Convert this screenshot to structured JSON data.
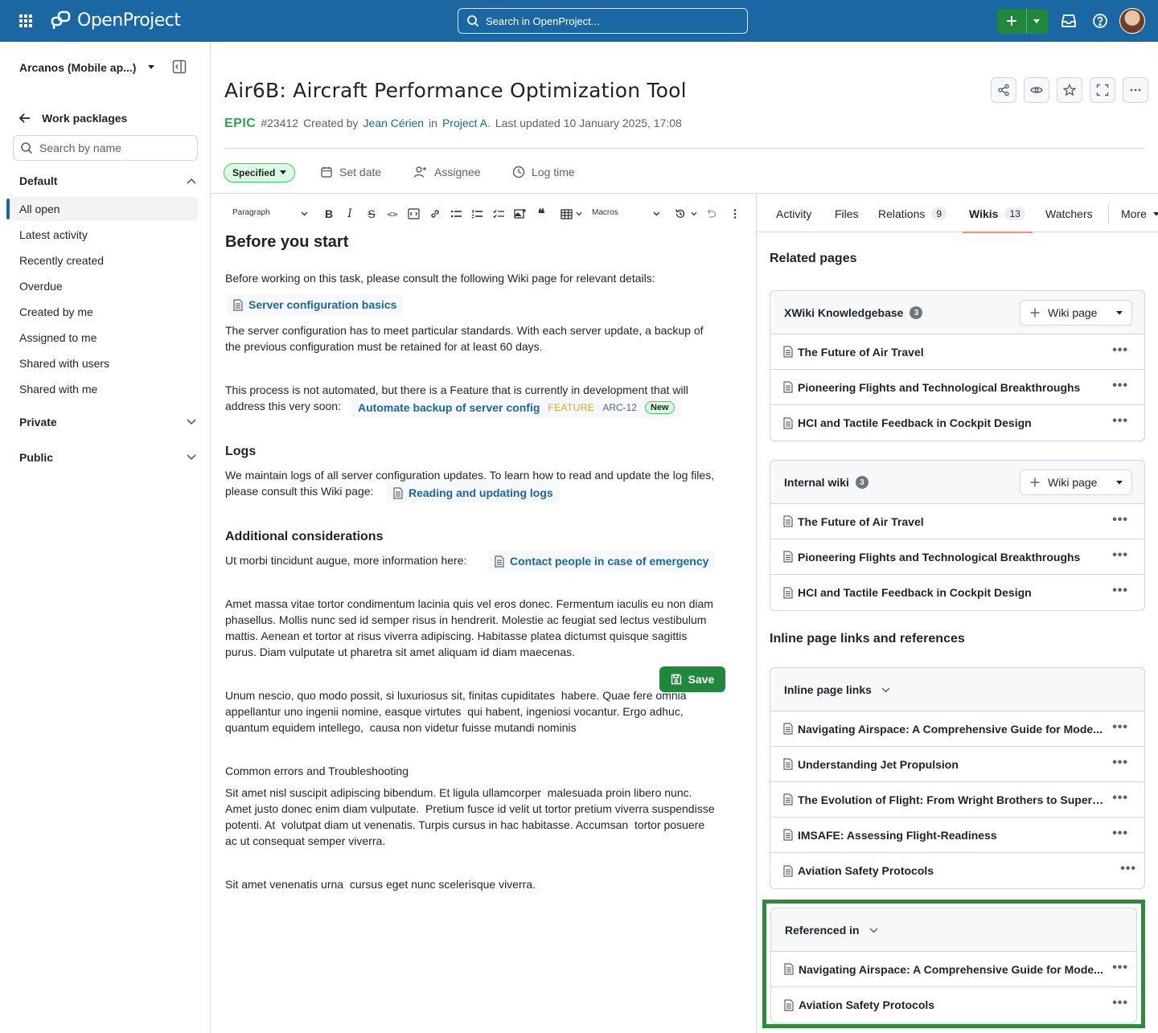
{
  "header": {
    "logo_text": "OpenProject",
    "search_placeholder": "Search in OpenProject...",
    "accent": "#1a67a3"
  },
  "sidebar": {
    "project": "Arcanos (Mobile ap...)",
    "back_label": "Work packlages",
    "search_placeholder": "Search by name",
    "groups": [
      {
        "label": "Default",
        "items": [
          "All open",
          "Latest activity",
          "Recently created",
          "Overdue",
          "Created by me",
          "Assigned to me",
          "Shared with users",
          "Shared with me"
        ]
      },
      {
        "label": "Private"
      },
      {
        "label": "Public"
      }
    ]
  },
  "work_package": {
    "title": "Air6B: Aircraft Performance Optimization Tool",
    "type": "EPIC",
    "id": "#23412",
    "created_by_prefix": "Created by",
    "author": "Jean Cérien",
    "in_word": "in",
    "project": "Project A.",
    "updated": "Last updated 10 January 2025, 17:08",
    "status": "Specified",
    "actions": [
      "Set date",
      "Assignee",
      "Log time"
    ]
  },
  "toolbar": {
    "paragraph": "Paragraph",
    "macros": "Macros"
  },
  "editor": {
    "h1": "Before you start",
    "p1": "Before working on this task, please consult the following Wiki page for relevant details:",
    "chip1": "Server configuration basics",
    "p2a": "The server configuration has to meet particular standards. With each server update, a backup of",
    "p2b": "the previous configuration must be retained for at least 60 days.",
    "p3a": "This process is not automated, but there is a Feature that is currently in development that will",
    "p3b": "address this very soon:",
    "feature_link": "Automate backup of server config",
    "feature_type": "FEATURE",
    "feature_id": "ARC-12",
    "feature_status": "New",
    "h_logs": "Logs",
    "logs_a": "We maintain logs of all server configuration updates. To learn how to read and update the log files,",
    "logs_b": "please consult this Wiki page:",
    "chip2": "Reading and updating logs",
    "h_add": "Additional considerations",
    "add_p": "Ut morbi tincidunt augue, more information here:",
    "chip3": "Contact people in case of emergency",
    "lorem1": [
      "Amet massa vitae tortor condimentum lacinia quis vel eros donec. Fermentum iaculis eu non diam",
      "phasellus. Mollis nunc sed id semper risus in hendrerit. Molestie ac feugiat sed lectus vestibulum",
      "mattis. Aenean et tortor at risus viverra adipiscing. Habitasse platea dictumst quisque sagittis",
      "purus. Diam vulputate ut pharetra sit amet aliquam id diam maecenas."
    ],
    "lorem2": [
      "Unum nescio, quo modo possit, si luxuriosus sit, finitas cupiditates  habere. Quae fere omnia",
      "appellantur uno ingenii nomine, easque virtutes  qui habent, ingeniosi vocantur. Ergo adhuc,",
      "quantum equidem intellego,  causa non videtur fuisse mutandi nominis"
    ],
    "h_common": "Common errors and Troubleshooting",
    "lorem3": [
      "Sit amet nisl suscipit adipiscing bibendum. Et ligula ullamcorper  malesuada proin libero nunc.",
      "Amet justo donec enim diam vulputate.  Pretium fusce id velit ut tortor pretium viverra suspendisse",
      "potenti. At  volutpat diam ut venenatis. Turpis cursus in hac habitasse. Accumsan  tortor posuere",
      "ac ut consequat semper viverra."
    ],
    "lorem4": "Sit amet venenatis urna  cursus eget nunc scelerisque viverra.",
    "save": "Save"
  },
  "tabs": {
    "activity": "Activity",
    "files": "Files",
    "relations": "Relations",
    "relations_count": "9",
    "wikis": "Wikis",
    "wikis_count": "13",
    "watchers": "Watchers",
    "more": "More"
  },
  "panel": {
    "related_title": "Related pages",
    "xwiki": {
      "label": "XWiki Knowledgebase",
      "count": "3",
      "button": "Wiki page",
      "rows": [
        "The Future of Air Travel",
        "Pioneering Flights and Technological Breakthroughs",
        "HCI and Tactile Feedback in Cockpit Design"
      ]
    },
    "internal": {
      "label": "Internal wiki",
      "count": "3",
      "button": "Wiki page",
      "rows": [
        "The Future of Air Travel",
        "Pioneering Flights and Technological Breakthroughs",
        "HCI and Tactile Feedback in Cockpit Design"
      ]
    },
    "inline_title": "Inline page links and references",
    "inline_links": {
      "label": "Inline page links",
      "rows": [
        "Navigating Airspace: A Comprehensive Guide for Mode...",
        "Understanding Jet Propulsion",
        "The Evolution of Flight: From Wright Brothers to Supers...",
        "IMSAFE: Assessing Flight-Readiness",
        "Aviation Safety Protocols"
      ]
    },
    "referenced": {
      "label": "Referenced in",
      "rows": [
        "Navigating Airspace: A Comprehensive Guide for Mode...",
        "Aviation Safety Protocols"
      ]
    }
  }
}
